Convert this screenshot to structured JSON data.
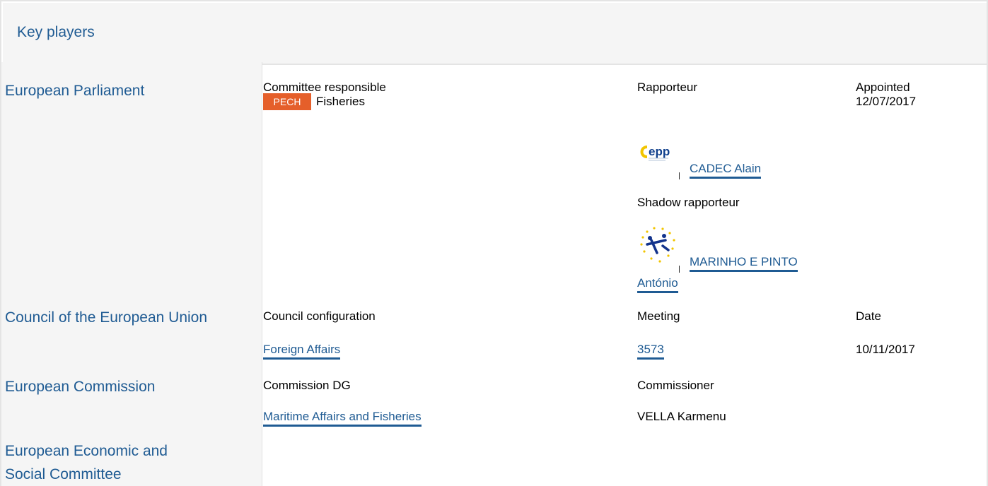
{
  "header": {
    "title": "Key players"
  },
  "institutions": {
    "parliament": "European Parliament",
    "council": "Council of the European Union",
    "commission": "European Commission",
    "eesc_line1": "European Economic and",
    "eesc_line2": "Social Committee"
  },
  "parliament": {
    "col_committee": "Committee responsible",
    "col_rapporteur": "Rapporteur",
    "col_appointed": "Appointed",
    "committee_badge": "PECH",
    "committee_name": "Fisheries",
    "appointed_date": "12/07/2017",
    "rapporteur_logo_text": "epp",
    "rapporteur_name": "CADEC Alain",
    "shadow_label": "Shadow rapporteur",
    "shadow_name_line1": "MARINHO E PINTO",
    "shadow_name_line2": "António"
  },
  "council": {
    "col_configuration": "Council configuration",
    "col_meeting": "Meeting",
    "col_date": "Date",
    "configuration": "Foreign Affairs",
    "meeting": "3573",
    "date": "10/11/2017"
  },
  "commission": {
    "col_dg": "Commission DG",
    "col_commissioner": "Commissioner",
    "dg": "Maritime Affairs and Fisheries",
    "commissioner": "VELLA Karmenu"
  },
  "colors": {
    "link": "#1f5b93",
    "badge": "#e55f2a",
    "panel": "#f5f5f5"
  }
}
